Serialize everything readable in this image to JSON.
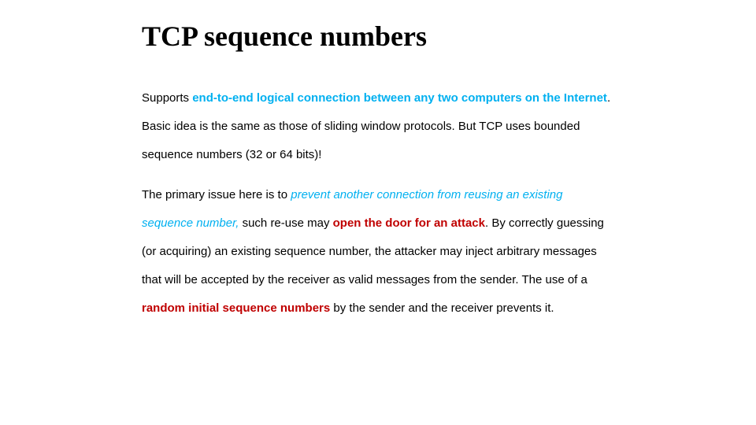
{
  "title": "TCP sequence numbers",
  "p1": {
    "lead": "Supports ",
    "emph": "end-to-end logical connection between any two computers on the Internet",
    "rest": ". Basic idea is the same as those of sliding window protocols. But TCP uses bounded sequence numbers (32 or 64 bits)!"
  },
  "p2": {
    "lead": "The primary issue here is to ",
    "emph1": "prevent another connection from reusing an existing sequence number,",
    "mid1": " such re-use may ",
    "emph2": "open the door for an attack",
    "mid2": ". By correctly guessing (or acquiring) an existing sequence number, the attacker may inject arbitrary messages that will be accepted by the receiver as valid messages from the sender. The use of a ",
    "emph3": "random initial sequence numbers",
    "tail": " by the sender and the receiver prevents it."
  }
}
